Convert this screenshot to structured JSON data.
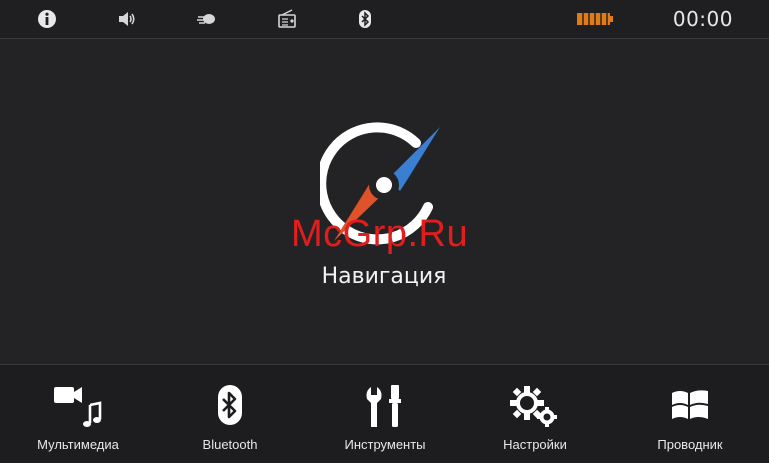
{
  "status_bar": {
    "icons": [
      "info-icon",
      "volume-icon",
      "satellite-icon",
      "radio-icon",
      "bluetooth-icon",
      "battery-icon"
    ],
    "time": "00:00",
    "battery_color": "#e07b1a"
  },
  "main": {
    "tile_label": "Навигация",
    "compass_colors": {
      "north": "#3a7fd1",
      "south": "#e0522a",
      "ring": "#ffffff"
    },
    "watermark": "McGrp.Ru",
    "watermark_color": "#e01e1e"
  },
  "dock": {
    "items": [
      {
        "label": "Мультимедиа",
        "icon": "multimedia-icon"
      },
      {
        "label": "Bluetooth",
        "icon": "bluetooth-icon"
      },
      {
        "label": "Инструменты",
        "icon": "tools-icon"
      },
      {
        "label": "Настройки",
        "icon": "settings-icon"
      },
      {
        "label": "Проводник",
        "icon": "explorer-icon"
      }
    ]
  }
}
